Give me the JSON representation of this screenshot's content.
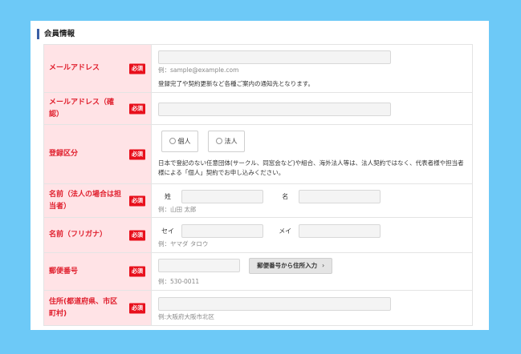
{
  "section": {
    "title": "会員情報"
  },
  "required_badge": "必須",
  "email": {
    "label": "メールアドレス",
    "value": "",
    "example": "例：sample@example.com",
    "note": "登録完了や契約更新など各種ご案内の通知先となります。"
  },
  "email_confirm": {
    "label": "メールアドレス（確認）",
    "value": ""
  },
  "registration_type": {
    "label": "登録区分",
    "options": [
      "個人",
      "法人"
    ],
    "note": "日本で登記のない任意団体(サークル、同窓会など)や組合、海外法人等は、法人契約ではなく、代表者様や担当者様による「個人」契約でお申し込みください。"
  },
  "name": {
    "label": "名前（法人の場合は担当者）",
    "last_label": "姓",
    "first_label": "名",
    "example": "例：山田 太郎"
  },
  "name_kana": {
    "label": "名前（フリガナ）",
    "last_label": "セイ",
    "first_label": "メイ",
    "example": "例：ヤマダ タロウ"
  },
  "postal": {
    "label": "郵便番号",
    "button": "郵便番号から住所入力",
    "button_icon": "chevron-right-icon",
    "example": "例：530-0011"
  },
  "address": {
    "label": "住所(都道府県、市区町村)",
    "example": "例:大阪府大阪市北区"
  },
  "colors": {
    "background": "#6dc9f7",
    "label_bg": "#ffe3e6",
    "label_text": "#e0202e",
    "required_badge": "#e8101c",
    "section_bar": "#3a5fa5"
  }
}
